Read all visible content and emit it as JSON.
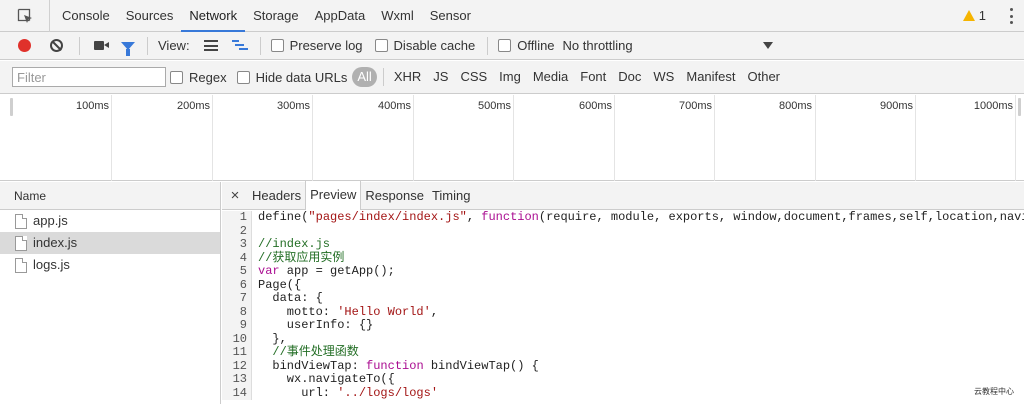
{
  "tabs": [
    "Console",
    "Sources",
    "Network",
    "Storage",
    "AppData",
    "Wxml",
    "Sensor"
  ],
  "active_tab": "Network",
  "warnings_count": "1",
  "toolbar": {
    "view_label": "View:",
    "preserve_log": "Preserve log",
    "disable_cache": "Disable cache",
    "offline": "Offline",
    "throttling": "No throttling"
  },
  "filter": {
    "placeholder": "Filter",
    "regex": "Regex",
    "hide_data_urls": "Hide data URLs",
    "types": [
      "All",
      "XHR",
      "JS",
      "CSS",
      "Img",
      "Media",
      "Font",
      "Doc",
      "WS",
      "Manifest",
      "Other"
    ]
  },
  "timeline_ticks": [
    "100ms",
    "200ms",
    "300ms",
    "400ms",
    "500ms",
    "600ms",
    "700ms",
    "800ms",
    "900ms",
    "1000ms"
  ],
  "name_column": {
    "header": "Name",
    "files": [
      "app.js",
      "index.js",
      "logs.js"
    ],
    "selected": "index.js"
  },
  "detail_tabs": [
    "Headers",
    "Preview",
    "Response",
    "Timing"
  ],
  "active_detail_tab": "Preview",
  "code": {
    "line_numbers": [
      "1",
      "2",
      "3",
      "4",
      "5",
      "6",
      "7",
      "8",
      "9",
      "10",
      "11",
      "12",
      "13",
      "14"
    ],
    "lines": [
      [
        [
          "plain",
          "define("
        ],
        [
          "str",
          "\"pages/index/index.js\""
        ],
        [
          "plain",
          ", "
        ],
        [
          "kw",
          "function"
        ],
        [
          "plain",
          "(require, module, exports, window,document,frames,self,location,naviga"
        ]
      ],
      [],
      [
        [
          "cm",
          "//index.js"
        ]
      ],
      [
        [
          "cm",
          "//获取应用实例"
        ]
      ],
      [
        [
          "kw",
          "var"
        ],
        [
          "plain",
          " app = getApp();"
        ]
      ],
      [
        [
          "plain",
          "Page({"
        ]
      ],
      [
        [
          "plain",
          "  data: {"
        ]
      ],
      [
        [
          "plain",
          "    motto: "
        ],
        [
          "str",
          "'Hello World'"
        ],
        [
          "plain",
          ","
        ]
      ],
      [
        [
          "plain",
          "    userInfo: {}"
        ]
      ],
      [
        [
          "plain",
          "  },"
        ]
      ],
      [
        [
          "cm",
          "  //事件处理函数"
        ]
      ],
      [
        [
          "plain",
          "  bindViewTap: "
        ],
        [
          "kw",
          "function"
        ],
        [
          "plain",
          " bindViewTap() {"
        ]
      ],
      [
        [
          "plain",
          "    wx.navigateTo({"
        ]
      ],
      [
        [
          "plain",
          "      url: "
        ],
        [
          "str",
          "'../logs/logs'"
        ]
      ]
    ]
  },
  "watermark": "云教程中心"
}
